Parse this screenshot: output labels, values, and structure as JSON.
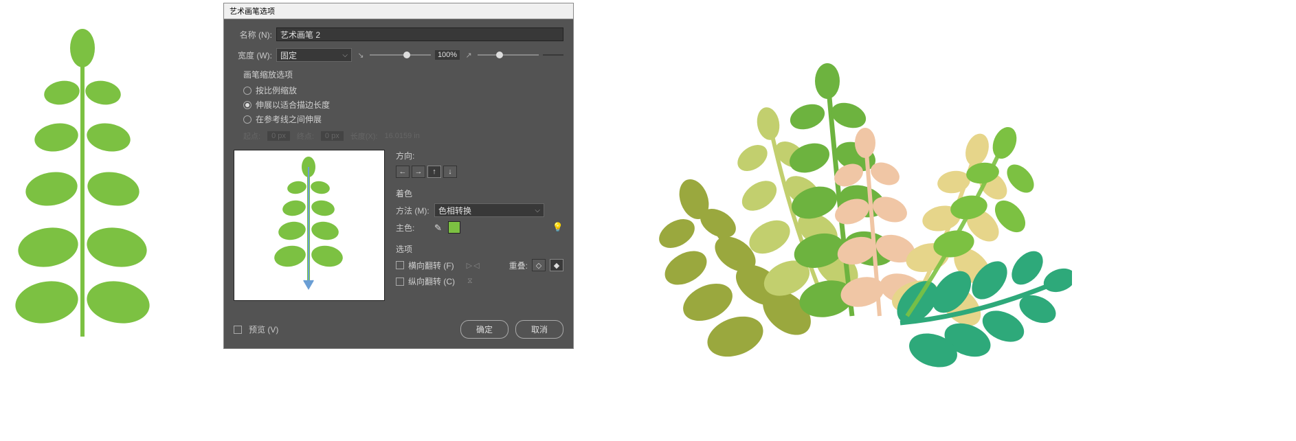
{
  "dialog": {
    "title": "艺术画笔选项",
    "name_label": "名称 (N):",
    "name_value": "艺术画笔 2",
    "width_label": "宽度 (W):",
    "width_mode": "固定",
    "width_percent": "100%",
    "scale_section": "画笔缩放选项",
    "scale_options": {
      "proportional": "按比例缩放",
      "stretch": "伸展以适合描边长度",
      "between_guides": "在参考线之间伸展"
    },
    "disabled": {
      "start_label": "起点:",
      "start_val": "0 px",
      "end_label": "终点:",
      "end_val": "0 px",
      "length_label": "长度(X):",
      "length_val": "16.0159 in"
    },
    "direction_label": "方向:",
    "coloring_label": "着色",
    "method_label": "方法 (M):",
    "method_value": "色相转换",
    "key_color_label": "主色:",
    "key_color_hex": "#7cc142",
    "options_label": "选项",
    "flip_h": "横向翻转 (F)",
    "flip_v": "纵向翻转 (C)",
    "overlap_label": "重叠:",
    "preview_label": "预览 (V)",
    "ok": "确定",
    "cancel": "取消"
  },
  "colors": {
    "plant_green": "#7cc142",
    "olive": "#9aa83e",
    "light_olive": "#b9c85f",
    "peach": "#f2c9a8",
    "cream": "#e9d89a",
    "teal": "#2ea97a",
    "bright_green": "#6db33f"
  }
}
